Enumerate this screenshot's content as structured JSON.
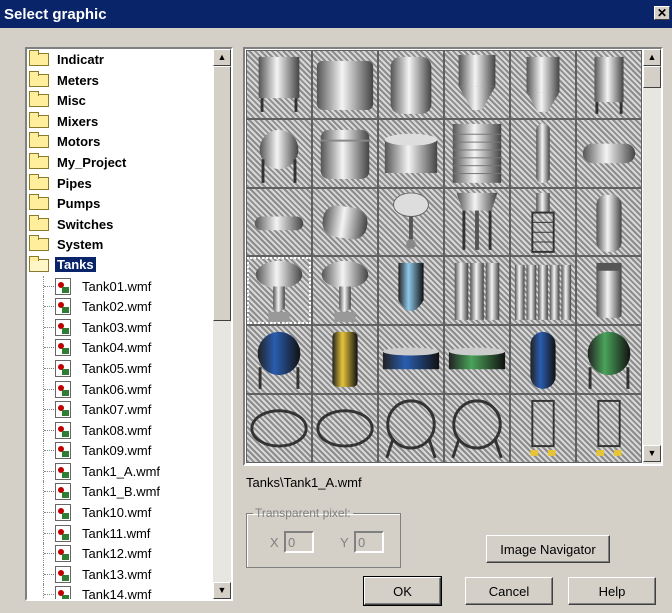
{
  "window": {
    "title": "Select graphic",
    "close_label": "✕"
  },
  "tree": {
    "folders": [
      {
        "label": "Indicatr"
      },
      {
        "label": "Meters"
      },
      {
        "label": "Misc"
      },
      {
        "label": "Mixers"
      },
      {
        "label": "Motors"
      },
      {
        "label": "My_Project"
      },
      {
        "label": "Pipes"
      },
      {
        "label": "Pumps"
      },
      {
        "label": "Switches"
      },
      {
        "label": "System"
      },
      {
        "label": "Tanks"
      }
    ],
    "selected_folder": "Tanks",
    "files": [
      {
        "label": "Tank01.wmf"
      },
      {
        "label": "Tank02.wmf"
      },
      {
        "label": "Tank03.wmf"
      },
      {
        "label": "Tank04.wmf"
      },
      {
        "label": "Tank05.wmf"
      },
      {
        "label": "Tank06.wmf"
      },
      {
        "label": "Tank07.wmf"
      },
      {
        "label": "Tank08.wmf"
      },
      {
        "label": "Tank09.wmf"
      },
      {
        "label": "Tank1_A.wmf"
      },
      {
        "label": "Tank1_B.wmf"
      },
      {
        "label": "Tank10.wmf"
      },
      {
        "label": "Tank11.wmf"
      },
      {
        "label": "Tank12.wmf"
      },
      {
        "label": "Tank13.wmf"
      },
      {
        "label": "Tank14.wmf"
      }
    ]
  },
  "gallery": {
    "icons": [
      "vertical-tank-legs-icon",
      "horizontal-cylinder-tank-icon",
      "domed-vertical-tank-icon",
      "cone-bottom-silo-icon",
      "tall-silo-icon",
      "tall-silo-legs-icon",
      "sphere-tank-icon",
      "ribbed-tank-icon",
      "low-cylinder-tank-icon",
      "storage-tank-striped-icon",
      "narrow-column-tank-icon",
      "horizontal-capsule-tank-icon",
      "horizontal-pipe-tank-icon",
      "tilted-drum-tank-icon",
      "water-tower-icon",
      "water-tower-legs-icon",
      "lattice-tower-icon",
      "tall-capsule-tank-icon",
      "hourglass-tank-selected-icon",
      "hourglass-tank-icon",
      "light-blue-cone-tank-icon",
      "triple-column-tank-icon",
      "multi-column-tank-icon",
      "dark-cylinder-tank-icon",
      "blue-sphere-tank-icon",
      "yellow-cylinder-tank-icon",
      "blue-shallow-tank-icon",
      "green-shallow-tank-icon",
      "blue-capsule-tank-icon",
      "green-sphere-tank-icon",
      "oval-tank-icon",
      "oval-tank-outline-icon",
      "round-tank-legs-icon",
      "round-tank-legs-dark-icon",
      "yellow-base-tank-icon",
      "yellow-base-tank-small-icon"
    ],
    "selected_index": 18,
    "colors": {
      "blue": "#2a5db0",
      "light_blue": "#8ec9ea",
      "yellow": "#e6c43a",
      "green": "#4aa35a"
    }
  },
  "path_text": "Tanks\\Tank1_A.wmf",
  "transparent_pixel": {
    "legend": "Transparent pixel:",
    "x_label": "X",
    "x_value": "0",
    "y_label": "Y",
    "y_value": "0"
  },
  "buttons": {
    "image_navigator": "Image Navigator",
    "ok": "OK",
    "cancel": "Cancel",
    "help": "Help"
  }
}
